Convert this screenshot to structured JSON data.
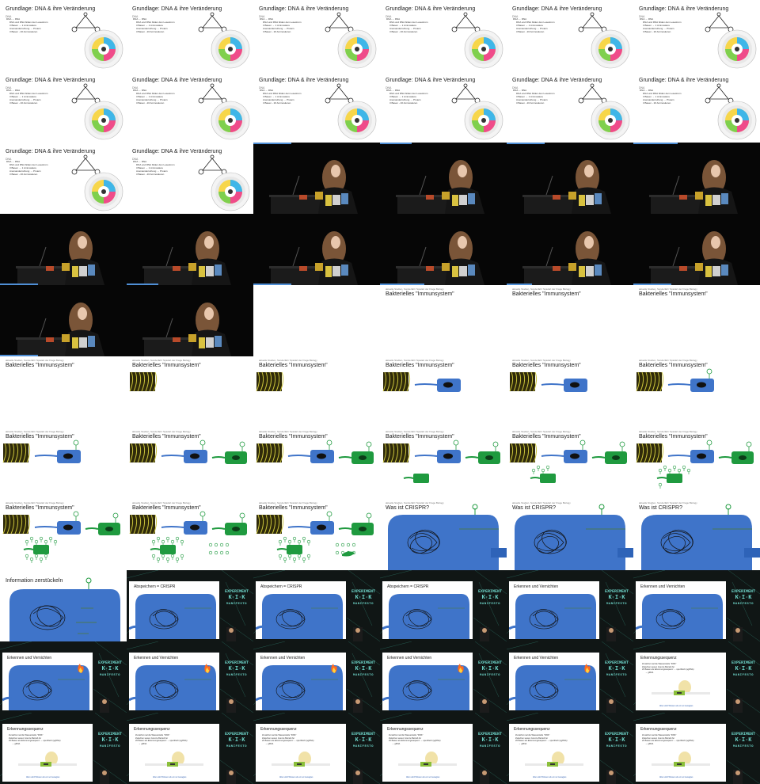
{
  "sheet": {
    "columns": 6,
    "rows": 11
  },
  "texts": {
    "dna_title": "Grundlage: DNA & ihre Veränderung",
    "dna_sub": "DNA",
    "dna_bullets": [
      "DNA → RNA",
      "DNA und RNA bilden den Lesestrom",
      "3 Basen → 1 Aminosäure",
      "Aneinanderreihung → Protein",
      "3 Basen - 20 Aminosäuren"
    ],
    "immune_small": "aktuelle Studien, Sonderfall / Spielart der Frage Biology",
    "immune_title": "Bakterielles \"Immunsystem\"",
    "crispr_title": "Was ist CRISPR?",
    "split_title": "Information zerstückeln",
    "store_title": "Abspeichern = CRISPR",
    "detect_title": "Erkennen und Vernichten",
    "seq_title": "Erkennungssequenz",
    "seq_bullets": [
      "Zunächst mal die Wasserstelle \"DNS\"",
      "Zwischen wesen Grenze Betrieb fur",
      "20 Basen als Erkennungssequenz → spezifisch (sgRNA)",
      "→ gRNA"
    ],
    "seq_caption": "Allen wird Wissen als ein so Gesagtes",
    "brand_line1": "EXPERIMENT",
    "brand_line2": "K·I·K",
    "brand_line3": "MANIFESTO"
  },
  "frames": [
    {
      "kind": "dna"
    },
    {
      "kind": "dna"
    },
    {
      "kind": "dna"
    },
    {
      "kind": "dna"
    },
    {
      "kind": "dna"
    },
    {
      "kind": "dna"
    },
    {
      "kind": "dna"
    },
    {
      "kind": "dna"
    },
    {
      "kind": "dna"
    },
    {
      "kind": "dna"
    },
    {
      "kind": "dna"
    },
    {
      "kind": "dna"
    },
    {
      "kind": "dna"
    },
    {
      "kind": "dna"
    },
    {
      "kind": "speaker",
      "progress": 0.3
    },
    {
      "kind": "speaker",
      "progress": 0.25
    },
    {
      "kind": "speaker",
      "progress": 0.3
    },
    {
      "kind": "speaker",
      "progress": 0.35
    },
    {
      "kind": "speaker2",
      "progress": 0.3
    },
    {
      "kind": "speaker2",
      "progress": 0.25
    },
    {
      "kind": "speaker2",
      "progress": 0.3
    },
    {
      "kind": "speaker2",
      "progress": 0.35
    },
    {
      "kind": "speaker2",
      "progress": 0.2
    },
    {
      "kind": "speaker2",
      "progress": 0.3
    },
    {
      "kind": "speaker2",
      "progress": 0.3
    },
    {
      "kind": "speaker2",
      "progress": 0.0
    },
    {
      "kind": "empty"
    },
    {
      "kind": "immune",
      "step": 0
    },
    {
      "kind": "immune",
      "step": 0
    },
    {
      "kind": "immune",
      "step": 0
    },
    {
      "kind": "immune",
      "step": 0
    },
    {
      "kind": "immune",
      "step": 1
    },
    {
      "kind": "immune",
      "step": 1
    },
    {
      "kind": "immune",
      "step": 2
    },
    {
      "kind": "immune",
      "step": 2
    },
    {
      "kind": "immune",
      "step": 3
    },
    {
      "kind": "immune",
      "step": 3
    },
    {
      "kind": "immune",
      "step": 4
    },
    {
      "kind": "immune",
      "step": 4
    },
    {
      "kind": "immune",
      "step": 5
    },
    {
      "kind": "immune",
      "step": 6
    },
    {
      "kind": "immune",
      "step": 7
    },
    {
      "kind": "immune",
      "step": 8
    },
    {
      "kind": "immune",
      "step": 9
    },
    {
      "kind": "immune",
      "step": 10
    },
    {
      "kind": "crispr",
      "fire": false
    },
    {
      "kind": "crispr",
      "fire": false
    },
    {
      "kind": "crispr",
      "fire": false
    },
    {
      "kind": "split"
    },
    {
      "kind": "conf",
      "title": "store_title",
      "fire": false
    },
    {
      "kind": "conf",
      "title": "store_title",
      "fire": false
    },
    {
      "kind": "conf",
      "title": "store_title",
      "fire": false
    },
    {
      "kind": "conf",
      "title": "detect_title",
      "fire": false
    },
    {
      "kind": "conf",
      "title": "detect_title",
      "fire": false
    },
    {
      "kind": "conf",
      "title": "detect_title",
      "fire": true
    },
    {
      "kind": "conf",
      "title": "detect_title",
      "fire": true
    },
    {
      "kind": "conf",
      "title": "detect_title",
      "fire": true
    },
    {
      "kind": "conf",
      "title": "detect_title",
      "fire": true
    },
    {
      "kind": "conf",
      "title": "detect_title",
      "fire": true
    },
    {
      "kind": "seq"
    },
    {
      "kind": "seq"
    },
    {
      "kind": "seq"
    },
    {
      "kind": "seq"
    },
    {
      "kind": "seq"
    },
    {
      "kind": "seq"
    },
    {
      "kind": "seq"
    }
  ],
  "colors": {
    "blue_cell": "#3f74c9",
    "green_cell": "#1f9a3f",
    "progress": "#4f8fd6",
    "brand": "#6cd2c6",
    "fire": "#ff6a1f"
  }
}
